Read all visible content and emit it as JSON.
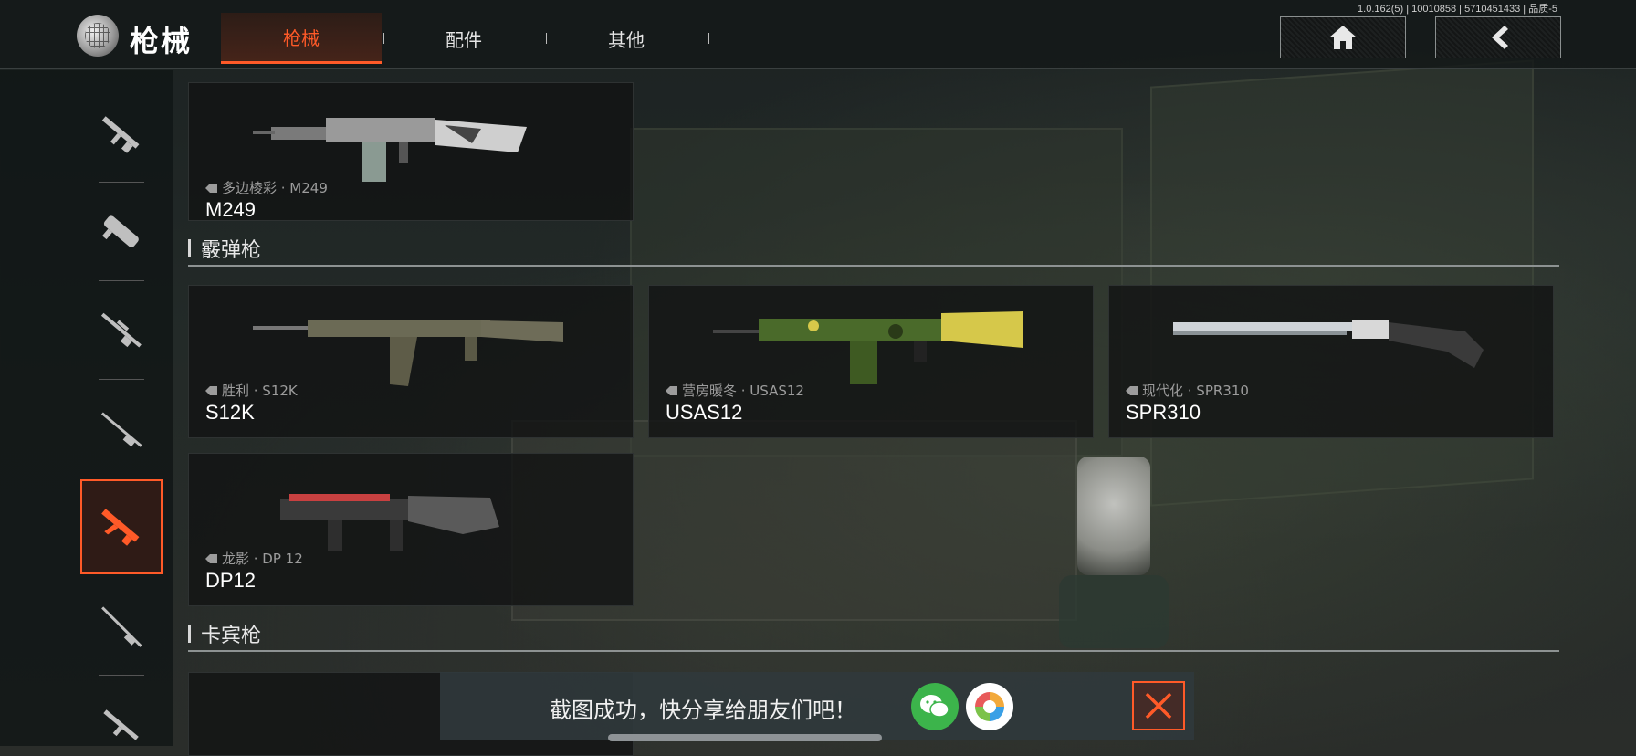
{
  "version_info": "1.0.162(5) | 10010858 | 5710451433 | 品质-5",
  "header": {
    "title": "枪械",
    "tabs": [
      {
        "label": "枪械",
        "active": true
      },
      {
        "label": "配件",
        "active": false
      },
      {
        "label": "其他",
        "active": false
      }
    ],
    "home_icon": "home-icon",
    "back_icon": "chevron-left-icon"
  },
  "sidebar": {
    "items": [
      {
        "icon": "assault-rifle-icon",
        "active": false
      },
      {
        "icon": "smg-icon",
        "active": false
      },
      {
        "icon": "sniper-icon",
        "active": false
      },
      {
        "icon": "marksman-rifle-icon",
        "active": false
      },
      {
        "icon": "rifle-icon",
        "active": true
      },
      {
        "icon": "long-rifle-icon",
        "active": false
      },
      {
        "icon": "carbine-icon",
        "active": false
      }
    ]
  },
  "top_card": {
    "skin": "多边棱彩 · M249",
    "name": "M249"
  },
  "sections": [
    {
      "title": "霰弹枪",
      "cards": [
        {
          "skin": "胜利 · S12K",
          "name": "S12K"
        },
        {
          "skin": "营房暖冬 · USAS12",
          "name": "USAS12"
        },
        {
          "skin": "现代化 · SPR310",
          "name": "SPR310"
        },
        {
          "skin": "龙影 · DP 12",
          "name": "DP12"
        }
      ]
    },
    {
      "title": "卡宾枪",
      "cards": []
    }
  ],
  "toast": {
    "message": "截图成功，快分享给朋友们吧！",
    "wechat_icon": "wechat-icon",
    "moments_icon": "moments-icon",
    "close_icon": "close-icon"
  },
  "colors": {
    "accent": "#ff5a28",
    "wechat_green": "#3cb44b"
  }
}
